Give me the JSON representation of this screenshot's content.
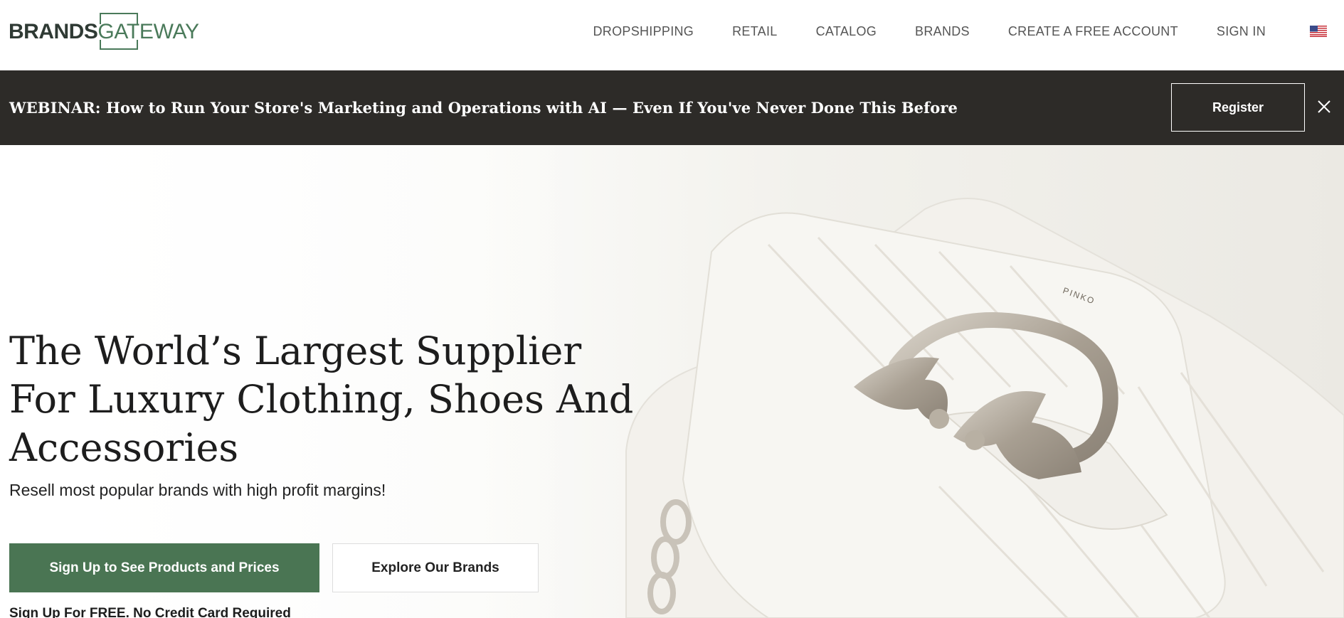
{
  "header": {
    "logo_bold": "BRANDS",
    "logo_light": "GATEWAY",
    "nav": [
      {
        "label": "DROPSHIPPING"
      },
      {
        "label": "RETAIL"
      },
      {
        "label": "CATALOG"
      },
      {
        "label": "BRANDS"
      },
      {
        "label": "CREATE A FREE ACCOUNT"
      },
      {
        "label": "SIGN IN"
      }
    ],
    "flag_icon": "us-flag-icon"
  },
  "banner": {
    "text": "WEBINAR: How to Run Your Store's Marketing and Operations with AI — Even If You've Never Done This Before",
    "register_label": "Register",
    "close_icon": "close-icon"
  },
  "hero": {
    "title": "The World’s Largest Supplier For Luxury Clothing, Shoes And Accessories",
    "subtitle": "Resell most popular brands with high profit margins!",
    "primary_cta": "Sign Up to See Products and Prices",
    "secondary_cta": "Explore Our Brands",
    "fine_print": "Sign Up For FREE. No Credit Card Required",
    "photo_brand_text": "PINKO"
  },
  "colors": {
    "brand_green": "#4a7553",
    "banner_bg": "#2d2b28",
    "logo_dark": "#2f3a34"
  }
}
